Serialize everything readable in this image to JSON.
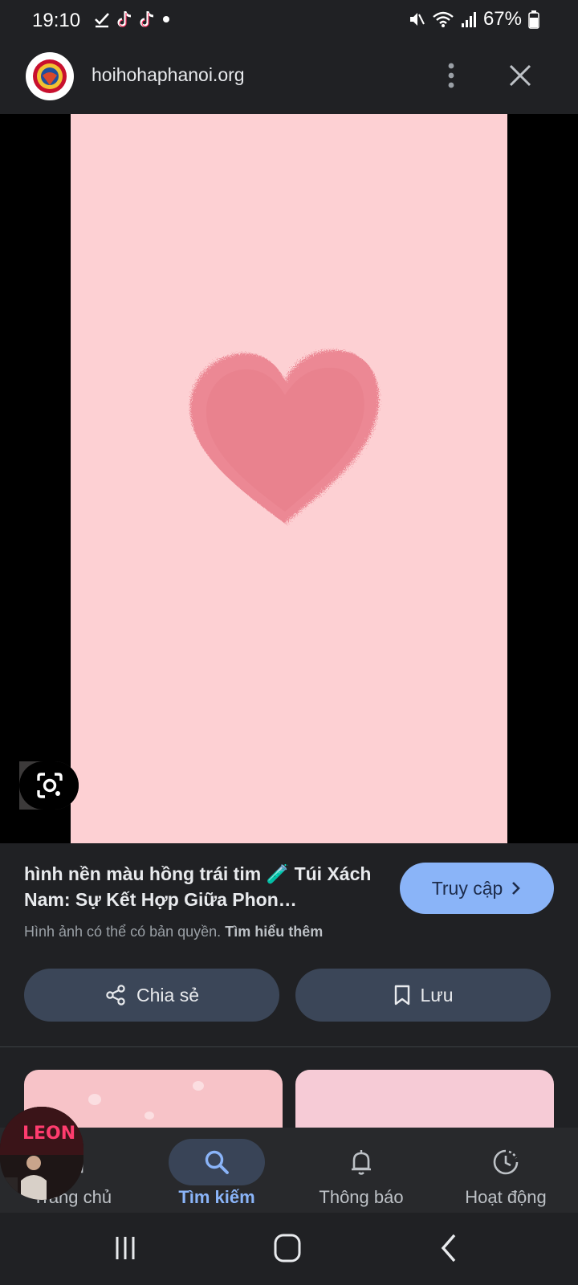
{
  "status_bar": {
    "time": "19:10",
    "battery": "67%"
  },
  "header": {
    "domain": "hoihohaphanoi.org"
  },
  "viewer": {
    "wallpaper_color": "#fdd0d3",
    "heart_color": "#ec8591"
  },
  "info": {
    "title": "hình nền màu hồng trái tim 🧪 Túi Xách Nam: Sự Kết Hợp Giữa Phon…",
    "visit_label": "Truy cập",
    "copyright_text": "Hình ảnh có thể có bản quyền.",
    "learn_more": "Tìm hiểu thêm",
    "share_label": "Chia sẻ",
    "save_label": "Lưu"
  },
  "bottom_nav": {
    "items": [
      {
        "label": "Trang chủ",
        "icon": "home-icon"
      },
      {
        "label": "Tìm kiếm",
        "icon": "search-icon"
      },
      {
        "label": "Thông báo",
        "icon": "bell-icon"
      },
      {
        "label": "Hoạt động",
        "icon": "activity-icon"
      }
    ],
    "active_index": 1
  },
  "colors": {
    "accent": "#8ab4f8",
    "surface": "#202124",
    "button_bg": "#3b4658"
  }
}
